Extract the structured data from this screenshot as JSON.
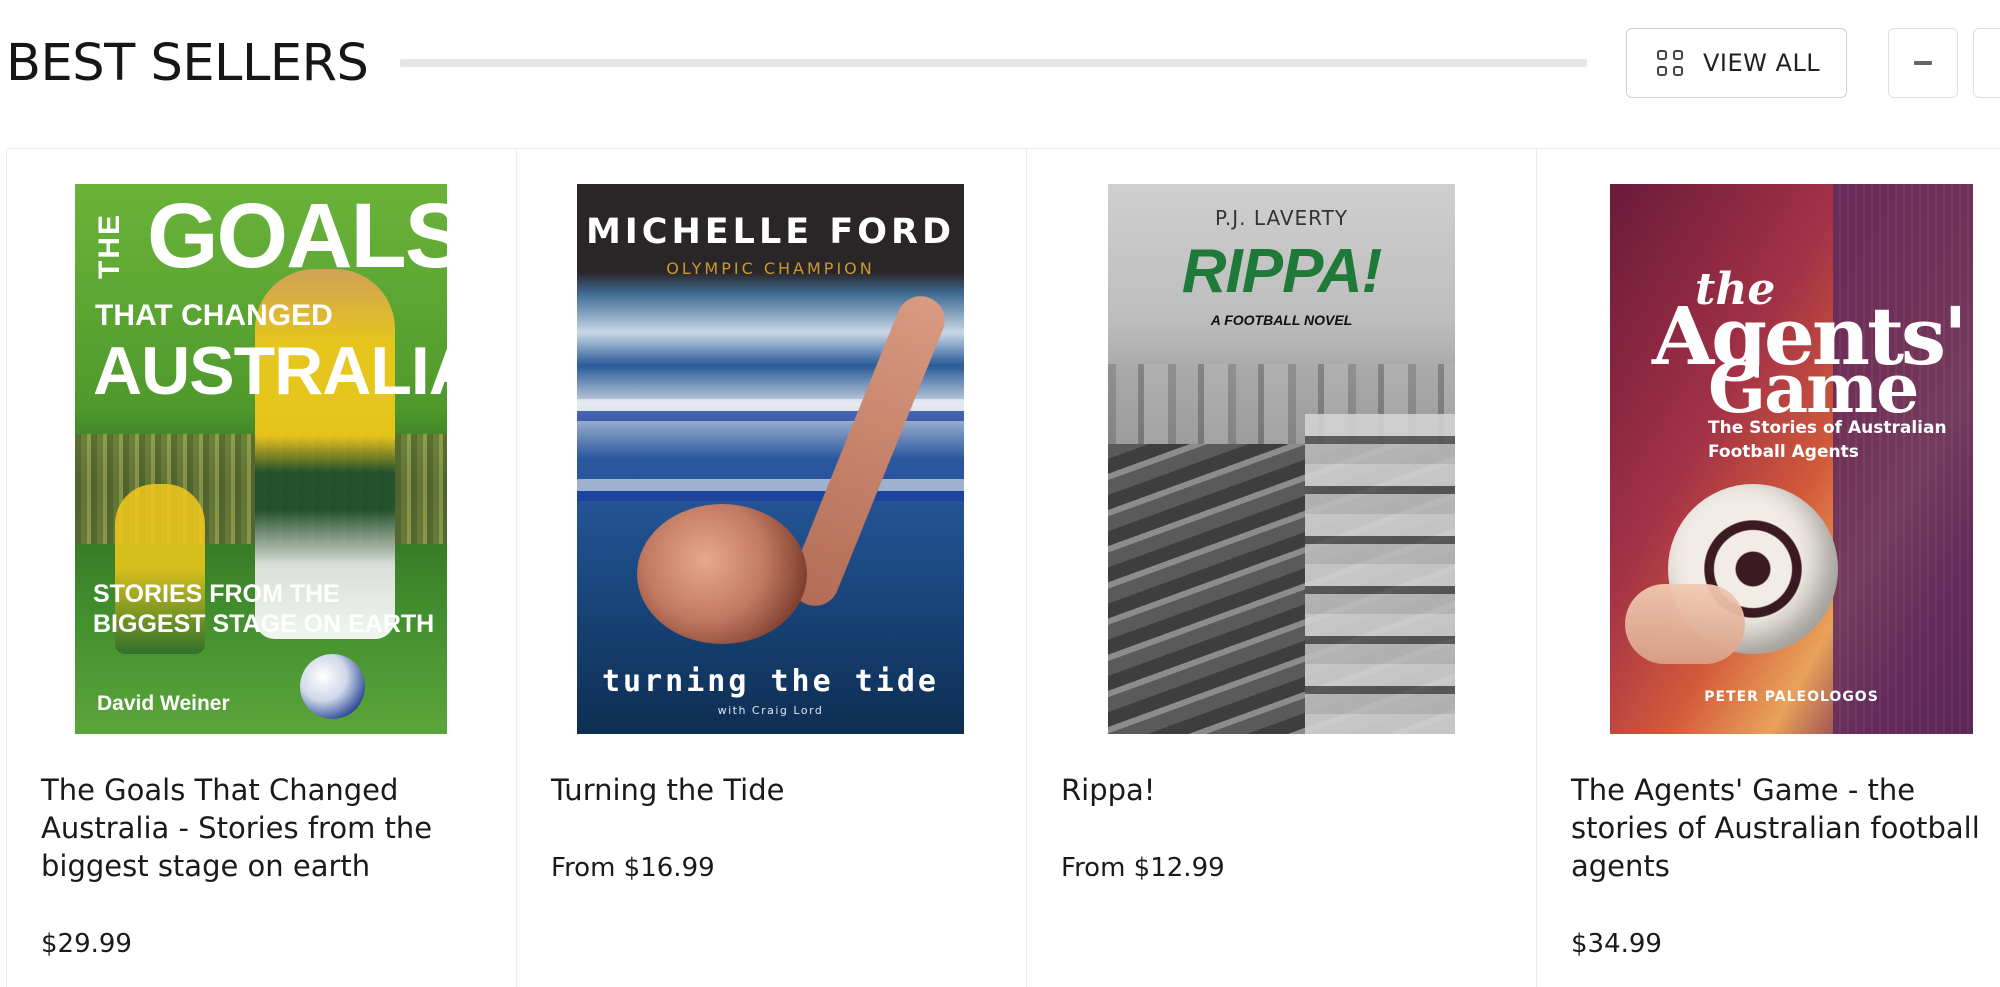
{
  "section": {
    "title": "BEST SELLERS",
    "view_all_label": "VIEW ALL",
    "grid_icon": "grid-icon",
    "prev_icon": "minus-icon"
  },
  "products": [
    {
      "name": "The Goals That Changed Australia - Stories from the biggest stage on earth",
      "price": "$29.99",
      "cover": {
        "line_the": "THE",
        "line_goals": "GOALS",
        "line_that": "THAT CHANGED",
        "line_australia": "AUSTRALIA",
        "line_stories": "STORIES FROM THE\nBIGGEST STAGE ON EARTH",
        "author": "David Weiner"
      }
    },
    {
      "name": "Turning the Tide",
      "price": "From $16.99",
      "cover": {
        "author": "MICHELLE FORD",
        "tagline": "OLYMPIC CHAMPION",
        "title": "turning the tide",
        "with": "with Craig Lord"
      }
    },
    {
      "name": "Rippa!",
      "price": "From $12.99",
      "cover": {
        "author": "P.J. LAVERTY",
        "title": "RIPPA!",
        "tagline": "A FOOTBALL NOVEL"
      }
    },
    {
      "name": "The Agents' Game - the stories of Australian football agents",
      "price": "$34.99",
      "cover": {
        "line_the": "the",
        "line_agents": "Agents'",
        "line_game": "Game",
        "subtitle": "The Stories of Australian\nFootball Agents",
        "author": "PETER PALEOLOGOS"
      }
    }
  ]
}
